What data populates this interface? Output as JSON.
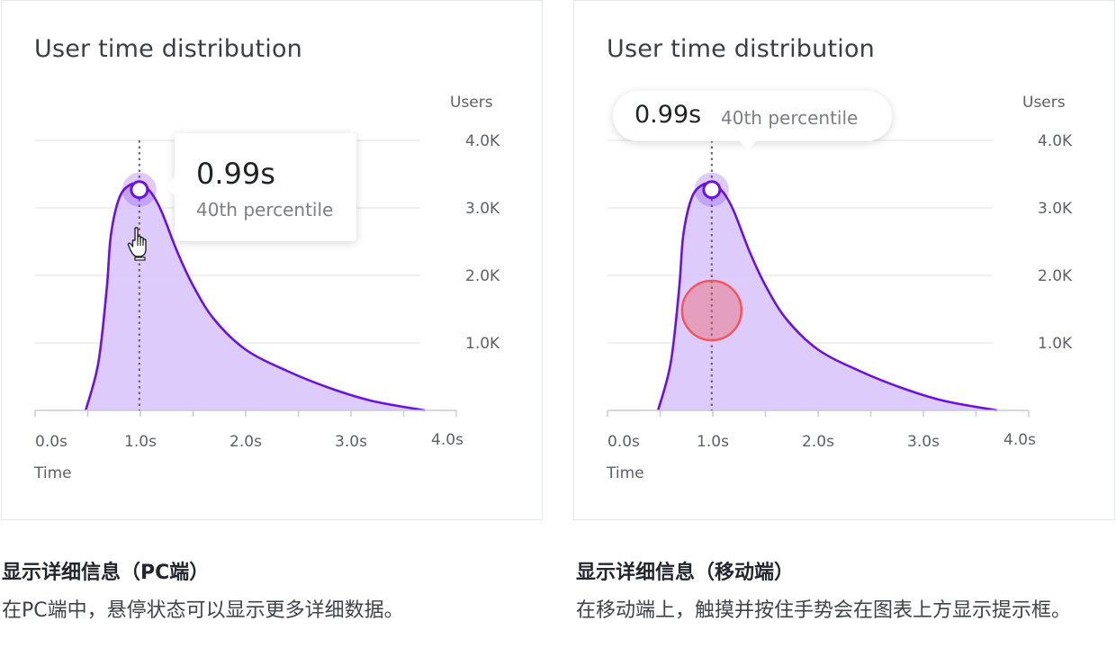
{
  "chart_data": [
    {
      "type": "area",
      "title": "User time distribution",
      "xlabel": "Time",
      "ylabel": "Users",
      "x_ticks": [
        "0.0s",
        "1.0s",
        "2.0s",
        "3.0s",
        "4.0s"
      ],
      "y_ticks": [
        "1.0K",
        "2.0K",
        "3.0K",
        "4.0K"
      ],
      "xlim": [
        0,
        4
      ],
      "ylim": [
        0,
        4000
      ],
      "grid": true,
      "series": [
        {
          "x": [
            0.48,
            0.6,
            0.68,
            0.72,
            0.8,
            0.9,
            1.0,
            1.1,
            1.2,
            1.35,
            1.5,
            1.7,
            2.0,
            2.4,
            2.8,
            3.2,
            3.7
          ],
          "values": [
            0,
            700,
            1800,
            2600,
            3150,
            3340,
            3350,
            3230,
            2950,
            2350,
            1850,
            1350,
            900,
            580,
            330,
            140,
            0
          ]
        }
      ],
      "highlight": {
        "x": 0.99,
        "value_label": "0.99s",
        "percentile_label": "40th percentile"
      },
      "colors": {
        "line": "#6a12e0",
        "fill": "#d9c6fb",
        "grid": "#e6e8eb",
        "dotted": "#6b6870"
      },
      "interaction": "hover"
    },
    {
      "type": "area",
      "title": "User time distribution",
      "xlabel": "Time",
      "ylabel": "Users",
      "x_ticks": [
        "0.0s",
        "1.0s",
        "2.0s",
        "3.0s",
        "4.0s"
      ],
      "y_ticks": [
        "1.0K",
        "2.0K",
        "3.0K",
        "4.0K"
      ],
      "xlim": [
        0,
        4
      ],
      "ylim": [
        0,
        4000
      ],
      "grid": true,
      "series": [
        {
          "x": [
            0.48,
            0.6,
            0.68,
            0.72,
            0.8,
            0.9,
            1.0,
            1.1,
            1.2,
            1.35,
            1.5,
            1.7,
            2.0,
            2.4,
            2.8,
            3.2,
            3.7
          ],
          "values": [
            0,
            700,
            1800,
            2600,
            3150,
            3340,
            3350,
            3230,
            2950,
            2350,
            1850,
            1350,
            900,
            580,
            330,
            140,
            0
          ]
        }
      ],
      "highlight": {
        "x": 0.99,
        "value_label": "0.99s",
        "percentile_label": "40th percentile"
      },
      "colors": {
        "line": "#6a12e0",
        "fill": "#d9c6fb",
        "grid": "#e6e8eb",
        "dotted": "#6b6870",
        "touch": "#f0575c"
      },
      "interaction": "touch"
    }
  ],
  "captions": [
    {
      "title": "显示详细信息（PC端）",
      "text": "在PC端中，悬停状态可以显示更多详细数据。"
    },
    {
      "title": "显示详细信息（移动端）",
      "text": "在移动端上，触摸并按住手势会在图表上方显示提示框。"
    }
  ],
  "icons": {
    "pc_cursor": "hand-pointer-icon"
  }
}
